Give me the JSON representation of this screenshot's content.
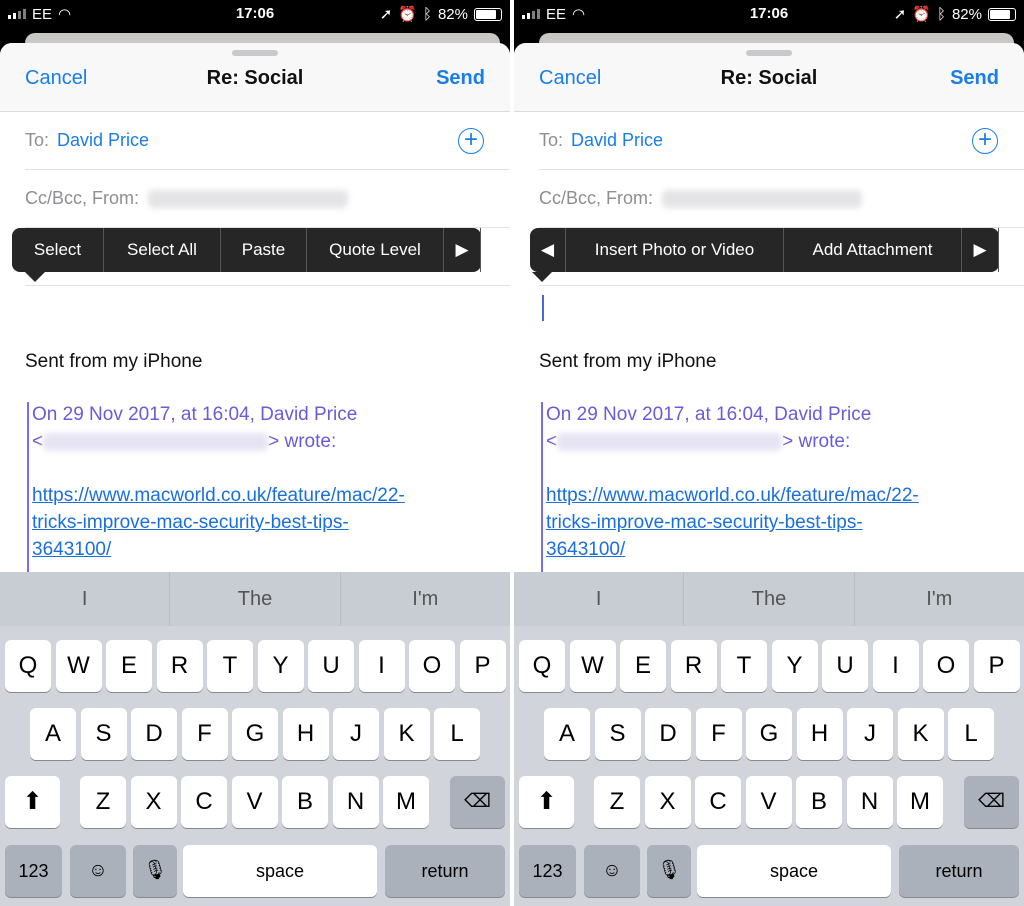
{
  "panels": [
    {
      "status": {
        "carrier": "EE",
        "time": "17:06",
        "battery": "82%",
        "battery_level": 0.82
      },
      "nav": {
        "cancel": "Cancel",
        "title": "Re: Social",
        "send": "Send"
      },
      "to_label": "To:",
      "to_value": "David Price",
      "cc_label": "Cc/Bcc, From:",
      "menu": {
        "items": [
          "Select",
          "Select All",
          "Paste",
          "Quote Level"
        ],
        "left_arrow": false,
        "right_arrow": true
      },
      "cursor_visible": false,
      "signature": "Sent from my iPhone",
      "quote": {
        "line1": "On 29 Nov 2017, at 16:04, David Price",
        "line2_prefix": "<",
        "line2_suffix": "> wrote:",
        "link1": "https://www.macworld.co.uk/feature/mac/22-",
        "link2": "tricks-improve-mac-security-best-tips-",
        "link3": "3643100/"
      },
      "suggestions": [
        "I",
        "The",
        "I'm"
      ]
    },
    {
      "status": {
        "carrier": "EE",
        "time": "17:06",
        "battery": "82%",
        "battery_level": 0.82
      },
      "nav": {
        "cancel": "Cancel",
        "title": "Re: Social",
        "send": "Send"
      },
      "to_label": "To:",
      "to_value": "David Price",
      "cc_label": "Cc/Bcc, From:",
      "menu": {
        "items": [
          "Insert Photo or Video",
          "Add Attachment"
        ],
        "left_arrow": true,
        "right_arrow": true
      },
      "cursor_visible": true,
      "signature": "Sent from my iPhone",
      "quote": {
        "line1": "On 29 Nov 2017, at 16:04, David Price",
        "line2_prefix": "<",
        "line2_suffix": "> wrote:",
        "link1": "https://www.macworld.co.uk/feature/mac/22-",
        "link2": "tricks-improve-mac-security-best-tips-",
        "link3": "3643100/"
      },
      "suggestions": [
        "I",
        "The",
        "I'm"
      ]
    }
  ],
  "keyboard": {
    "row1": [
      "Q",
      "W",
      "E",
      "R",
      "T",
      "Y",
      "U",
      "I",
      "O",
      "P"
    ],
    "row2": [
      "A",
      "S",
      "D",
      "F",
      "G",
      "H",
      "J",
      "K",
      "L"
    ],
    "row3": [
      "Z",
      "X",
      "C",
      "V",
      "B",
      "N",
      "M"
    ],
    "numbers": "123",
    "space": "space",
    "return": "return"
  },
  "colors": {
    "accent": "#1a7ee6",
    "quote": "#6a5cd6",
    "link": "#1a6fd8"
  }
}
